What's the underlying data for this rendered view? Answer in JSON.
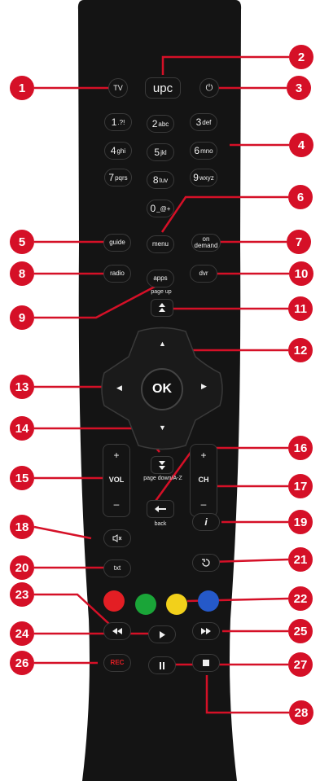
{
  "buttons": {
    "tv": "TV",
    "upc": "upc",
    "power": "⏻",
    "digits": [
      {
        "d": "1",
        "s": ".?!"
      },
      {
        "d": "2",
        "s": "abc"
      },
      {
        "d": "3",
        "s": "def"
      },
      {
        "d": "4",
        "s": "ghi"
      },
      {
        "d": "5",
        "s": "jkl"
      },
      {
        "d": "6",
        "s": "mno"
      },
      {
        "d": "7",
        "s": "pqrs"
      },
      {
        "d": "8",
        "s": "tuv"
      },
      {
        "d": "9",
        "s": "wxyz"
      },
      {
        "d": "0",
        "s": "_@+"
      }
    ],
    "guide": "guide",
    "menu": "menu",
    "on_demand": "on demand",
    "radio": "radio",
    "apps": "apps",
    "dvr": "dvr",
    "page_up": "page up",
    "ok": "OK",
    "page_down": "page down/A-Z",
    "vol_plus": "+",
    "vol_label": "VOL",
    "vol_minus": "–",
    "ch_plus": "+",
    "ch_label": "CH",
    "ch_minus": "–",
    "back": "back",
    "info": "i",
    "txt": "txt",
    "rec": "REC"
  },
  "colors": {
    "red": "#e31e24",
    "green": "#1aa538",
    "yellow": "#f2d01b",
    "blue": "#2559c9",
    "badge": "#d51027",
    "remote": "#141414"
  },
  "icons": {
    "mute": "mute-icon",
    "replay": "replay-icon",
    "rewind": "rewind-icon",
    "play": "play-icon",
    "fast_forward": "fast-forward-icon",
    "pause": "pause-icon",
    "stop": "stop-icon"
  },
  "callouts": [
    "1",
    "2",
    "3",
    "4",
    "5",
    "6",
    "7",
    "8",
    "9",
    "10",
    "11",
    "12",
    "13",
    "14",
    "15",
    "16",
    "17",
    "18",
    "19",
    "20",
    "21",
    "22",
    "23",
    "24",
    "25",
    "26",
    "27",
    "28"
  ]
}
